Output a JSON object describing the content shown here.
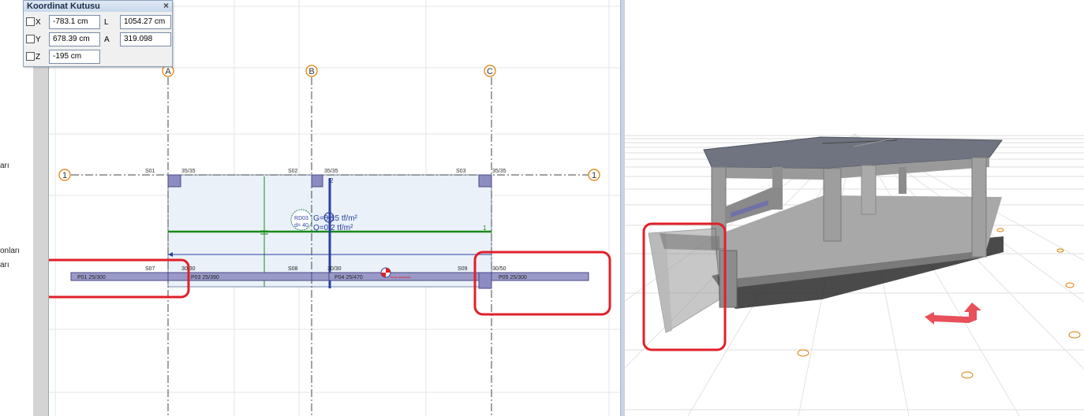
{
  "left_edge": {
    "texts": [
      "arı",
      "onları",
      "arı"
    ]
  },
  "coord_box": {
    "title": "Koordinat Kutusu",
    "close": "×",
    "x_label": "X",
    "x_value": "-783.1 cm",
    "y_label": "Y",
    "y_value": "678.39 cm",
    "z_label": "Z",
    "z_value": "-195 cm",
    "l_label": "L",
    "l_value": "1054.27 cm",
    "a_label": "A",
    "a_value": "319.098"
  },
  "plan": {
    "axes_vertical": [
      "A",
      "B",
      "C"
    ],
    "axes_horizontal": [
      "1",
      "1"
    ],
    "columns_top": [
      {
        "name": "S01",
        "size": "35/35"
      },
      {
        "name": "S02",
        "size": "35/35"
      },
      {
        "name": "S03",
        "size": "35/35"
      }
    ],
    "columns_bottom": [
      {
        "name": "S07",
        "size": "30/30"
      },
      {
        "name": "S08",
        "size": "30/30"
      },
      {
        "name": "S09",
        "size": "30/50"
      }
    ],
    "beams": [
      "P01 25/300",
      "P03 25/390",
      "P04 25/470",
      "P05 25/300"
    ],
    "slab_label": "RD03",
    "slab_thickness": "d= 40",
    "load_g": "G=0.15 tf/m²",
    "load_q": "Q=0.2 tf/m²",
    "beam_mark_2": "2",
    "beam_mark_1": "1",
    "colors": {
      "slab_fill": "#eaf1f8",
      "beam_fill": "#9a9ac8",
      "column_fill": "#8c8cc2",
      "axis_orange": "#e07a00",
      "green_line": "#1a8a1a",
      "highlight_red": "#e0202a"
    }
  },
  "view3d": {
    "axis_marker_color": "#e8505a"
  }
}
